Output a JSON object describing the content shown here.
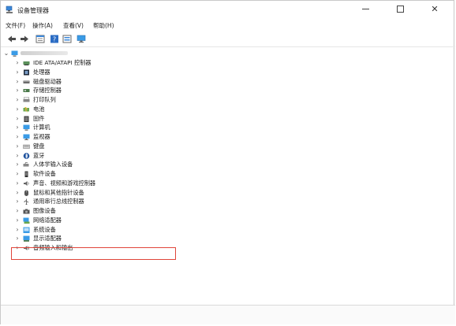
{
  "window": {
    "title": "设备管理器"
  },
  "menu": {
    "items": [
      "文件(F)",
      "操作(A)",
      "查看(V)",
      "帮助(H)"
    ]
  },
  "toolbar": {
    "icons": [
      "back-arrow-icon",
      "forward-arrow-icon",
      "properties-icon",
      "help-icon",
      "details-icon",
      "monitor-icon"
    ]
  },
  "tree": {
    "root_icon": "computer-icon",
    "items": [
      {
        "label": "IDE ATA/ATAPI 控制器",
        "icon": "ide-controller-icon"
      },
      {
        "label": "处理器",
        "icon": "processor-icon"
      },
      {
        "label": "磁盘驱动器",
        "icon": "disk-drive-icon"
      },
      {
        "label": "存储控制器",
        "icon": "storage-controller-icon"
      },
      {
        "label": "打印队列",
        "icon": "printer-icon"
      },
      {
        "label": "电池",
        "icon": "battery-icon"
      },
      {
        "label": "固件",
        "icon": "firmware-icon"
      },
      {
        "label": "计算机",
        "icon": "computer-icon"
      },
      {
        "label": "监视器",
        "icon": "monitor-icon"
      },
      {
        "label": "键盘",
        "icon": "keyboard-icon"
      },
      {
        "label": "蓝牙",
        "icon": "bluetooth-icon"
      },
      {
        "label": "人体学输入设备",
        "icon": "hid-icon"
      },
      {
        "label": "软件设备",
        "icon": "software-device-icon"
      },
      {
        "label": "声音、视频和游戏控制器",
        "icon": "sound-icon"
      },
      {
        "label": "鼠标和其他指针设备",
        "icon": "mouse-icon"
      },
      {
        "label": "通用串行总线控制器",
        "icon": "usb-icon"
      },
      {
        "label": "图像设备",
        "icon": "camera-icon"
      },
      {
        "label": "网络适配器",
        "icon": "network-icon"
      },
      {
        "label": "系统设备",
        "icon": "system-device-icon"
      },
      {
        "label": "显示适配器",
        "icon": "display-adapter-icon"
      },
      {
        "label": "音频输入和输出",
        "icon": "audio-io-icon"
      }
    ]
  },
  "colors": {
    "highlight_border": "#e0453a",
    "accent": "#2b7bd6"
  }
}
